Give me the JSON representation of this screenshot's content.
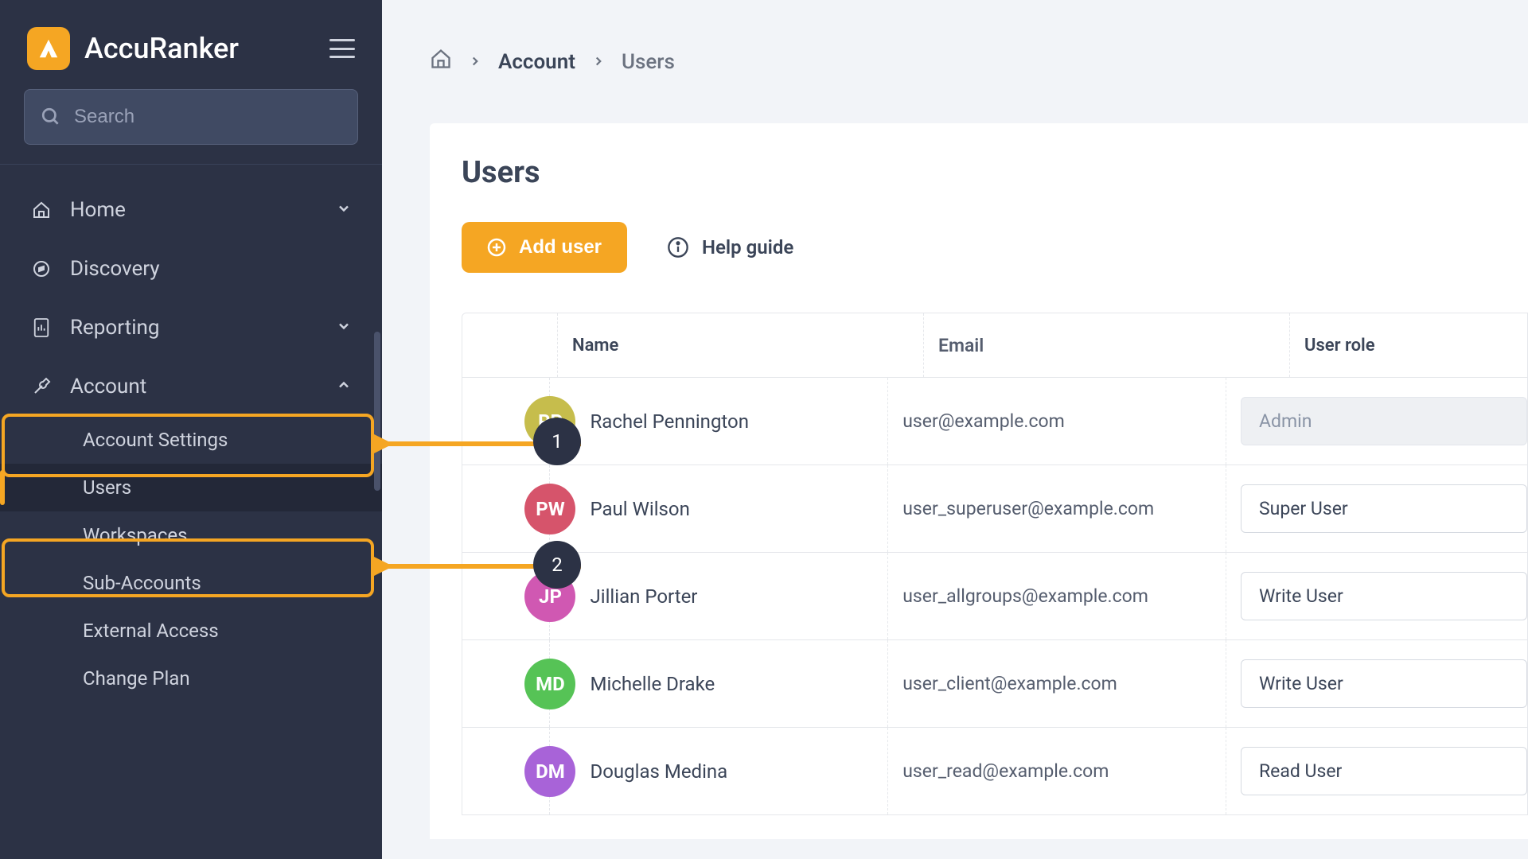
{
  "brand": "AccuRanker",
  "search": {
    "placeholder": "Search"
  },
  "sidebar": {
    "items": [
      {
        "label": "Home"
      },
      {
        "label": "Discovery"
      },
      {
        "label": "Reporting"
      },
      {
        "label": "Account"
      }
    ],
    "account_sub": [
      {
        "label": "Account Settings"
      },
      {
        "label": "Users"
      },
      {
        "label": "Workspaces"
      },
      {
        "label": "Sub-Accounts"
      },
      {
        "label": "External Access"
      },
      {
        "label": "Change Plan"
      }
    ]
  },
  "breadcrumb": {
    "level1": "Account",
    "level2": "Users"
  },
  "page": {
    "title": "Users"
  },
  "buttons": {
    "add_user": "Add user",
    "help_guide": "Help guide"
  },
  "table": {
    "headers": {
      "name": "Name",
      "email": "Email",
      "role": "User role"
    },
    "rows": [
      {
        "initials": "RP",
        "color": "#c6bd4c",
        "name": "Rachel Pennington",
        "email": "user@example.com",
        "role": "Admin",
        "role_disabled": true
      },
      {
        "initials": "PW",
        "color": "#d6546b",
        "name": "Paul Wilson",
        "email": "user_superuser@example.com",
        "role": "Super User",
        "role_disabled": false
      },
      {
        "initials": "JP",
        "color": "#d058b2",
        "name": "Jillian Porter",
        "email": "user_allgroups@example.com",
        "role": "Write User",
        "role_disabled": false
      },
      {
        "initials": "MD",
        "color": "#56c356",
        "name": "Michelle Drake",
        "email": "user_client@example.com",
        "role": "Write User",
        "role_disabled": false
      },
      {
        "initials": "DM",
        "color": "#a863d8",
        "name": "Douglas Medina",
        "email": "user_read@example.com",
        "role": "Read User",
        "role_disabled": false
      }
    ]
  },
  "annotations": {
    "badge1": "1",
    "badge2": "2"
  }
}
